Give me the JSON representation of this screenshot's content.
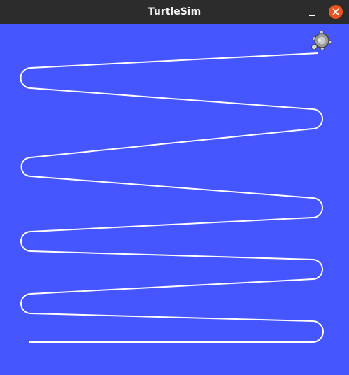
{
  "window": {
    "title": "TurtleSim",
    "background_color": "#4556ff",
    "titlebar_color": "#2c2c2c",
    "close_button_color": "#e95420"
  },
  "controls": {
    "minimize_icon": "minimize-icon",
    "close_icon": "close-icon"
  },
  "canvas": {
    "pen_color": "#ffffff",
    "turtle_icon": "turtle-icon"
  }
}
